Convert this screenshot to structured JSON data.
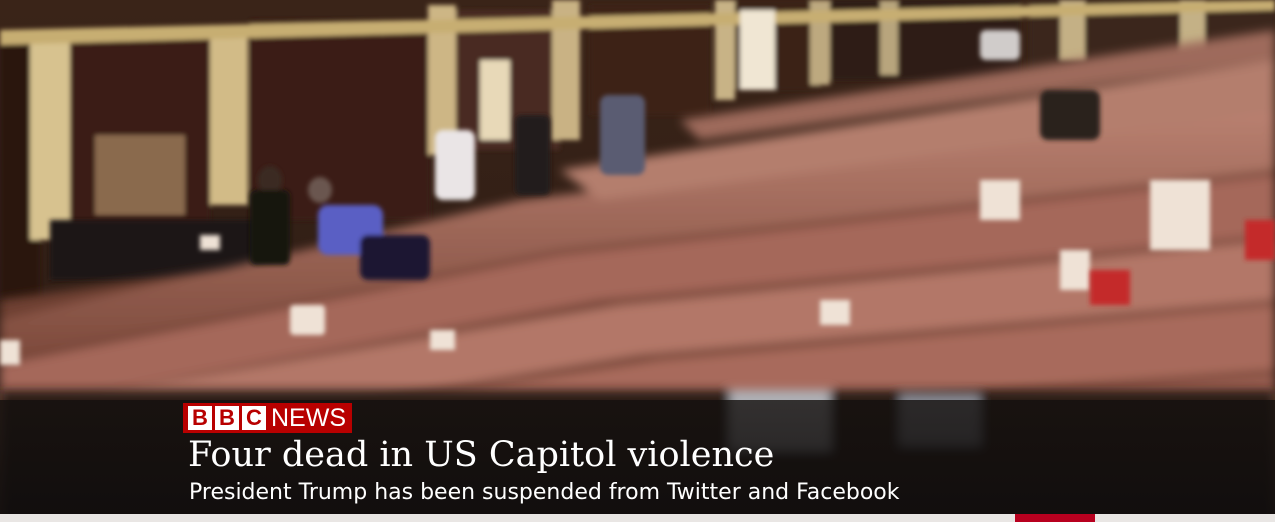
{
  "broadcast": {
    "brand": {
      "letters": [
        "B",
        "B",
        "C"
      ],
      "word": "NEWS",
      "color": "#b80000"
    },
    "headline": "Four dead in US Capitol violence",
    "subheadline": "President Trump has been suspended from Twitter and Facebook",
    "ticker_accent_color": "#b8001f"
  }
}
